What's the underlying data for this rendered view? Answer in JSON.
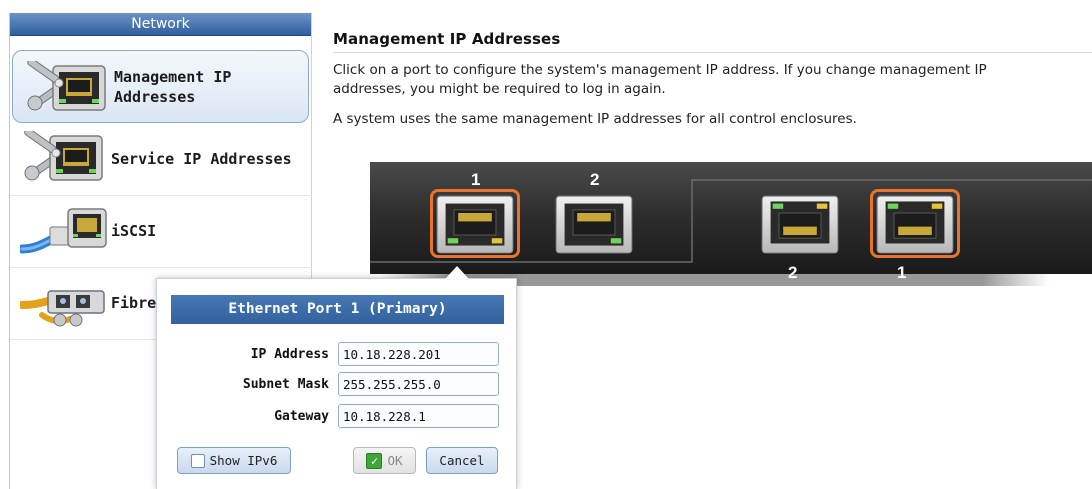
{
  "sidebar": {
    "header": "Network",
    "items": [
      {
        "label_line1": "Management IP",
        "label_line2": "Addresses",
        "icon": "ethernet-wrench-icon",
        "selected": true
      },
      {
        "label": "Service IP Addresses",
        "icon": "ethernet-wrench-icon"
      },
      {
        "label": "iSCSI",
        "icon": "ethernet-cable-icon"
      },
      {
        "label": "Fibre",
        "icon": "fibre-channel-icon"
      }
    ]
  },
  "main": {
    "title": "Management IP Addresses",
    "description_line1": "Click on a port to configure the system's management IP address. If you change management IP",
    "description_line2": "addresses, you might be required to log in again.",
    "description2": "A system uses the same management IP addresses for all control enclosures."
  },
  "panel": {
    "left_ports": [
      "1",
      "2"
    ],
    "right_ports": [
      "2",
      "1"
    ],
    "highlight_color": "#e8732a"
  },
  "popup": {
    "title": "Ethernet Port 1 (Primary)",
    "ip_label": "IP Address",
    "ip_value": "10.18.228.201",
    "subnet_label": "Subnet Mask",
    "subnet_value": "255.255.255.0",
    "gateway_label": "Gateway",
    "gateway_value": "10.18.228.1",
    "show_ipv6_label": "Show IPv6",
    "ok_label": "OK",
    "cancel_label": "Cancel"
  }
}
